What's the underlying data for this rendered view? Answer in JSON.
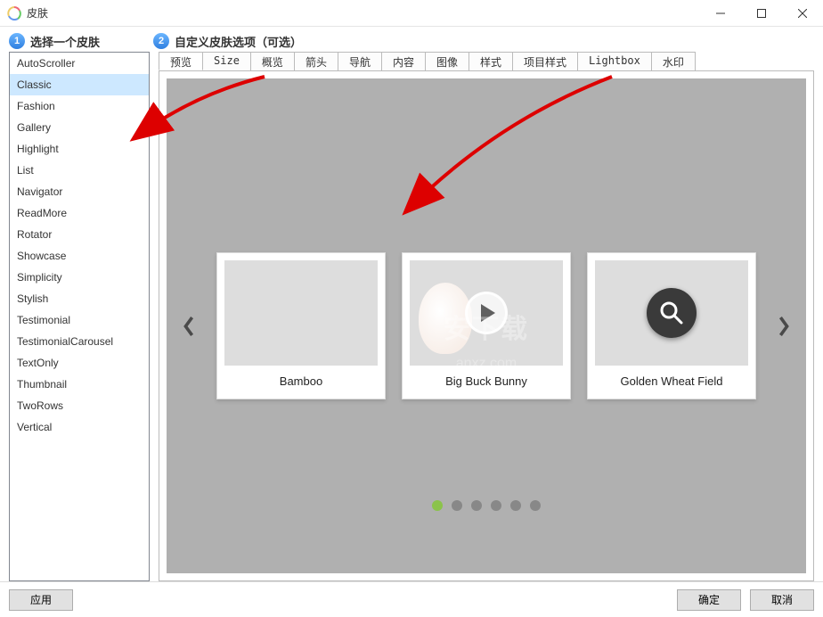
{
  "window": {
    "title": "皮肤"
  },
  "steps": {
    "one_num": "1",
    "one_label": "选择一个皮肤",
    "two_num": "2",
    "two_label": "自定义皮肤选项（可选）"
  },
  "skins": {
    "items": [
      {
        "label": "AutoScroller"
      },
      {
        "label": "Classic"
      },
      {
        "label": "Fashion"
      },
      {
        "label": "Gallery"
      },
      {
        "label": "Highlight"
      },
      {
        "label": "List"
      },
      {
        "label": "Navigator"
      },
      {
        "label": "ReadMore"
      },
      {
        "label": "Rotator"
      },
      {
        "label": "Showcase"
      },
      {
        "label": "Simplicity"
      },
      {
        "label": "Stylish"
      },
      {
        "label": "Testimonial"
      },
      {
        "label": "TestimonialCarousel"
      },
      {
        "label": "TextOnly"
      },
      {
        "label": "Thumbnail"
      },
      {
        "label": "TwoRows"
      },
      {
        "label": "Vertical"
      }
    ],
    "selected_index": 1
  },
  "tabs": {
    "items": [
      {
        "label": "预览"
      },
      {
        "label": "Size"
      },
      {
        "label": "概览"
      },
      {
        "label": "箭头"
      },
      {
        "label": "导航"
      },
      {
        "label": "内容"
      },
      {
        "label": "图像"
      },
      {
        "label": "样式"
      },
      {
        "label": "项目样式"
      },
      {
        "label": "Lightbox"
      },
      {
        "label": "水印"
      }
    ],
    "active_index": 0
  },
  "carousel": {
    "items": [
      {
        "caption": "Bamboo"
      },
      {
        "caption": "Big Buck Bunny"
      },
      {
        "caption": "Golden Wheat Field"
      }
    ],
    "dots_count": 6,
    "active_dot": 0
  },
  "buttons": {
    "apply": "应用",
    "ok": "确定",
    "cancel": "取消"
  },
  "watermark": {
    "main": "安下载",
    "sub": "anxz.com"
  }
}
